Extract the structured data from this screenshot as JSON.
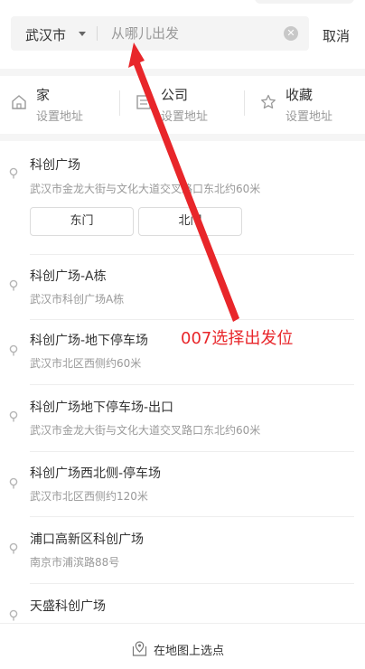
{
  "header": {
    "city": "武汉市",
    "search_placeholder": "从哪儿出发",
    "search_value": "",
    "cancel_label": "取消"
  },
  "shortcuts": [
    {
      "title": "家",
      "sub": "设置地址",
      "icon": "home-icon"
    },
    {
      "title": "公司",
      "sub": "设置地址",
      "icon": "office-icon"
    },
    {
      "title": "收藏",
      "sub": "设置地址",
      "icon": "star-icon"
    }
  ],
  "places": [
    {
      "name": "科创广场",
      "addr": "武汉市金龙大街与文化大道交叉路口东北约60米",
      "gates": [
        "东门",
        "北门"
      ]
    },
    {
      "name": "科创广场-A栋",
      "addr": "武汉市科创广场A栋"
    },
    {
      "name": "科创广场-地下停车场",
      "addr": "武汉市北区西侧约60米"
    },
    {
      "name": "科创广场地下停车场-出口",
      "addr": "武汉市金龙大街与文化大道交叉路口东北约60米"
    },
    {
      "name": "科创广场西北侧-停车场",
      "addr": "武汉市北区西侧约120米"
    },
    {
      "name": "浦口高新区科创广场",
      "addr": "南京市浦滨路88号"
    },
    {
      "name": "天盛科创广场",
      "addr": ""
    }
  ],
  "bottom": {
    "label": "在地图上选点",
    "icon": "map-pin-icon"
  },
  "annotation": {
    "text": "007选择出发位",
    "color": "#e8262a"
  }
}
